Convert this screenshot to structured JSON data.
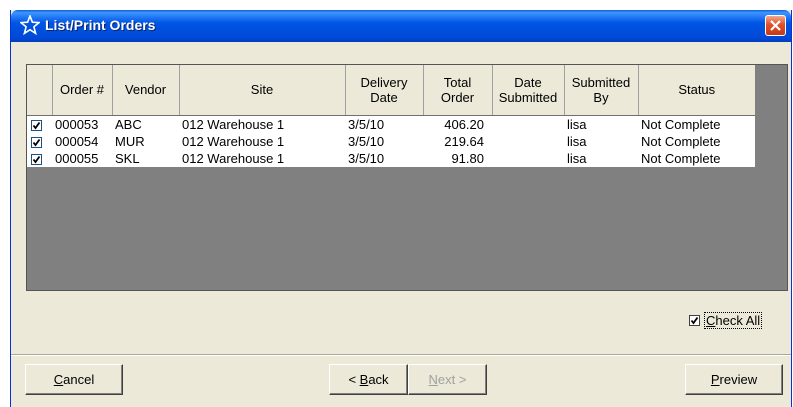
{
  "window": {
    "title": "List/Print Orders",
    "icon": "star-icon"
  },
  "grid": {
    "columns": [
      "",
      "Order #",
      "Vendor",
      "Site",
      "Delivery\nDate",
      "Total\nOrder",
      "Date\nSubmitted",
      "Submitted\nBy",
      "Status"
    ],
    "rows": [
      {
        "checked": true,
        "order": "000053",
        "vendor": "ABC",
        "site": "012 Warehouse 1",
        "delivery_date": "3/5/10",
        "total": "406.20",
        "date_submitted": "",
        "submitted_by": "lisa",
        "status": "Not Complete"
      },
      {
        "checked": true,
        "order": "000054",
        "vendor": "MUR",
        "site": "012 Warehouse 1",
        "delivery_date": "3/5/10",
        "total": "219.64",
        "date_submitted": "",
        "submitted_by": "lisa",
        "status": "Not Complete"
      },
      {
        "checked": true,
        "order": "000055",
        "vendor": "SKL",
        "site": "012 Warehouse 1",
        "delivery_date": "3/5/10",
        "total": "91.80",
        "date_submitted": "",
        "submitted_by": "lisa",
        "status": "Not Complete"
      }
    ]
  },
  "check_all": {
    "label_prefix": "C",
    "label_rest": "heck All",
    "checked": true
  },
  "buttons": {
    "cancel": {
      "hot": "C",
      "rest": "ancel"
    },
    "back": {
      "pre": "< ",
      "hot": "B",
      "rest": "ack"
    },
    "next": {
      "hot": "N",
      "rest": "ext >",
      "enabled": false
    },
    "preview": {
      "hot": "P",
      "rest": "review"
    }
  },
  "colors": {
    "titlebar": "#0055e5",
    "face": "#ece9d8",
    "grid_bg": "#808080",
    "close": "#e0502a"
  }
}
